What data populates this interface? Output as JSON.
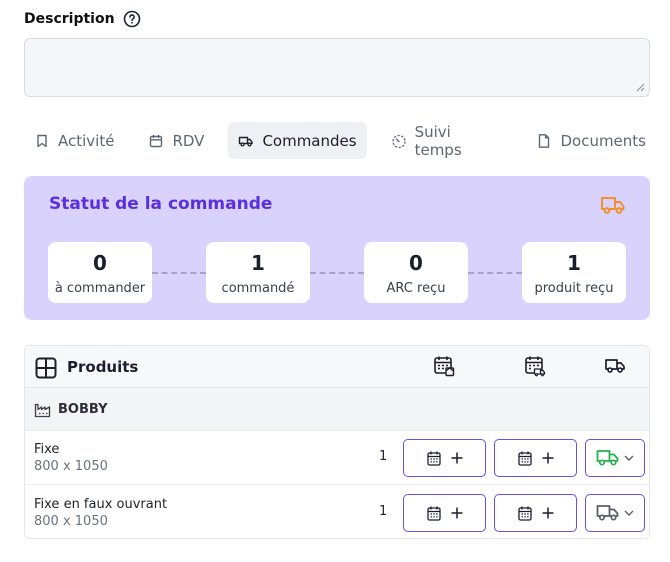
{
  "description": {
    "label": "Description",
    "value": ""
  },
  "tabs": [
    {
      "label": "Activité",
      "icon": "bookmark-icon",
      "active": false
    },
    {
      "label": "RDV",
      "icon": "calendar-icon",
      "active": false
    },
    {
      "label": "Commandes",
      "icon": "truck-icon",
      "active": true
    },
    {
      "label": "Suivi temps",
      "icon": "timer-icon",
      "active": false
    },
    {
      "label": "Documents",
      "icon": "document-icon",
      "active": false
    }
  ],
  "order_status": {
    "title": "Statut de la commande",
    "stats": [
      {
        "value": "0",
        "label": "à commander"
      },
      {
        "value": "1",
        "label": "commandé"
      },
      {
        "value": "0",
        "label": "ARC reçu"
      },
      {
        "value": "1",
        "label": "produit reçu"
      }
    ]
  },
  "products": {
    "title": "Produits",
    "header_icons": [
      "calendar-order-icon",
      "calendar-delivery-icon",
      "truck-icon"
    ],
    "group": {
      "name": "BOBBY",
      "icon": "factory-icon"
    },
    "rows": [
      {
        "name": "Fixe",
        "dimensions": "800 x 1050",
        "quantity": "1",
        "delivery_status": "received",
        "truck_color": "#22b14c"
      },
      {
        "name": "Fixe en faux ouvrant",
        "dimensions": "800 x 1050",
        "quantity": "1",
        "delivery_status": "pending",
        "truck_color": "#5a5f68"
      }
    ]
  },
  "colors": {
    "accent": "#5b2fe0",
    "status_bg": "#d9d2fc",
    "truck_orange": "#f5902a",
    "button_border": "#6d4ce8"
  }
}
